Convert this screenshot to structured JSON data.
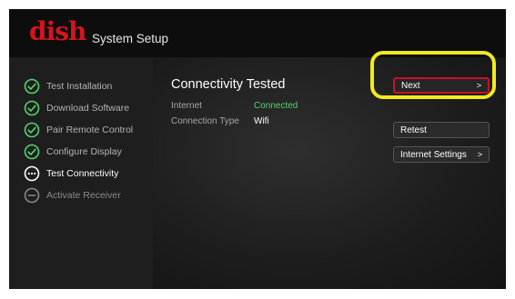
{
  "header": {
    "brand": "dish",
    "title": "System Setup"
  },
  "sidebar": {
    "steps": [
      {
        "label": "Test Installation",
        "status": "complete",
        "icon": "check-circle-icon"
      },
      {
        "label": "Download Software",
        "status": "complete",
        "icon": "check-circle-icon"
      },
      {
        "label": "Pair Remote Control",
        "status": "complete",
        "icon": "check-circle-icon"
      },
      {
        "label": "Configure Display",
        "status": "complete",
        "icon": "check-circle-icon"
      },
      {
        "label": "Test Connectivity",
        "status": "current",
        "icon": "ellipsis-circle-icon"
      },
      {
        "label": "Activate Receiver",
        "status": "pending",
        "icon": "minus-circle-icon"
      }
    ]
  },
  "main": {
    "title": "Connectivity Tested",
    "rows": [
      {
        "label": "Internet",
        "value": "Connected"
      },
      {
        "label": "Connection Type",
        "value": "Wifi"
      }
    ]
  },
  "actions": {
    "next_label": "Next",
    "retest_label": "Retest",
    "internet_settings_label": "Internet Settings",
    "chevron": ">"
  },
  "colors": {
    "brand_red": "#d4141d",
    "complete_green": "#55d26a",
    "focus_red": "#c8102e",
    "highlight_yellow": "#f2ea1c"
  }
}
